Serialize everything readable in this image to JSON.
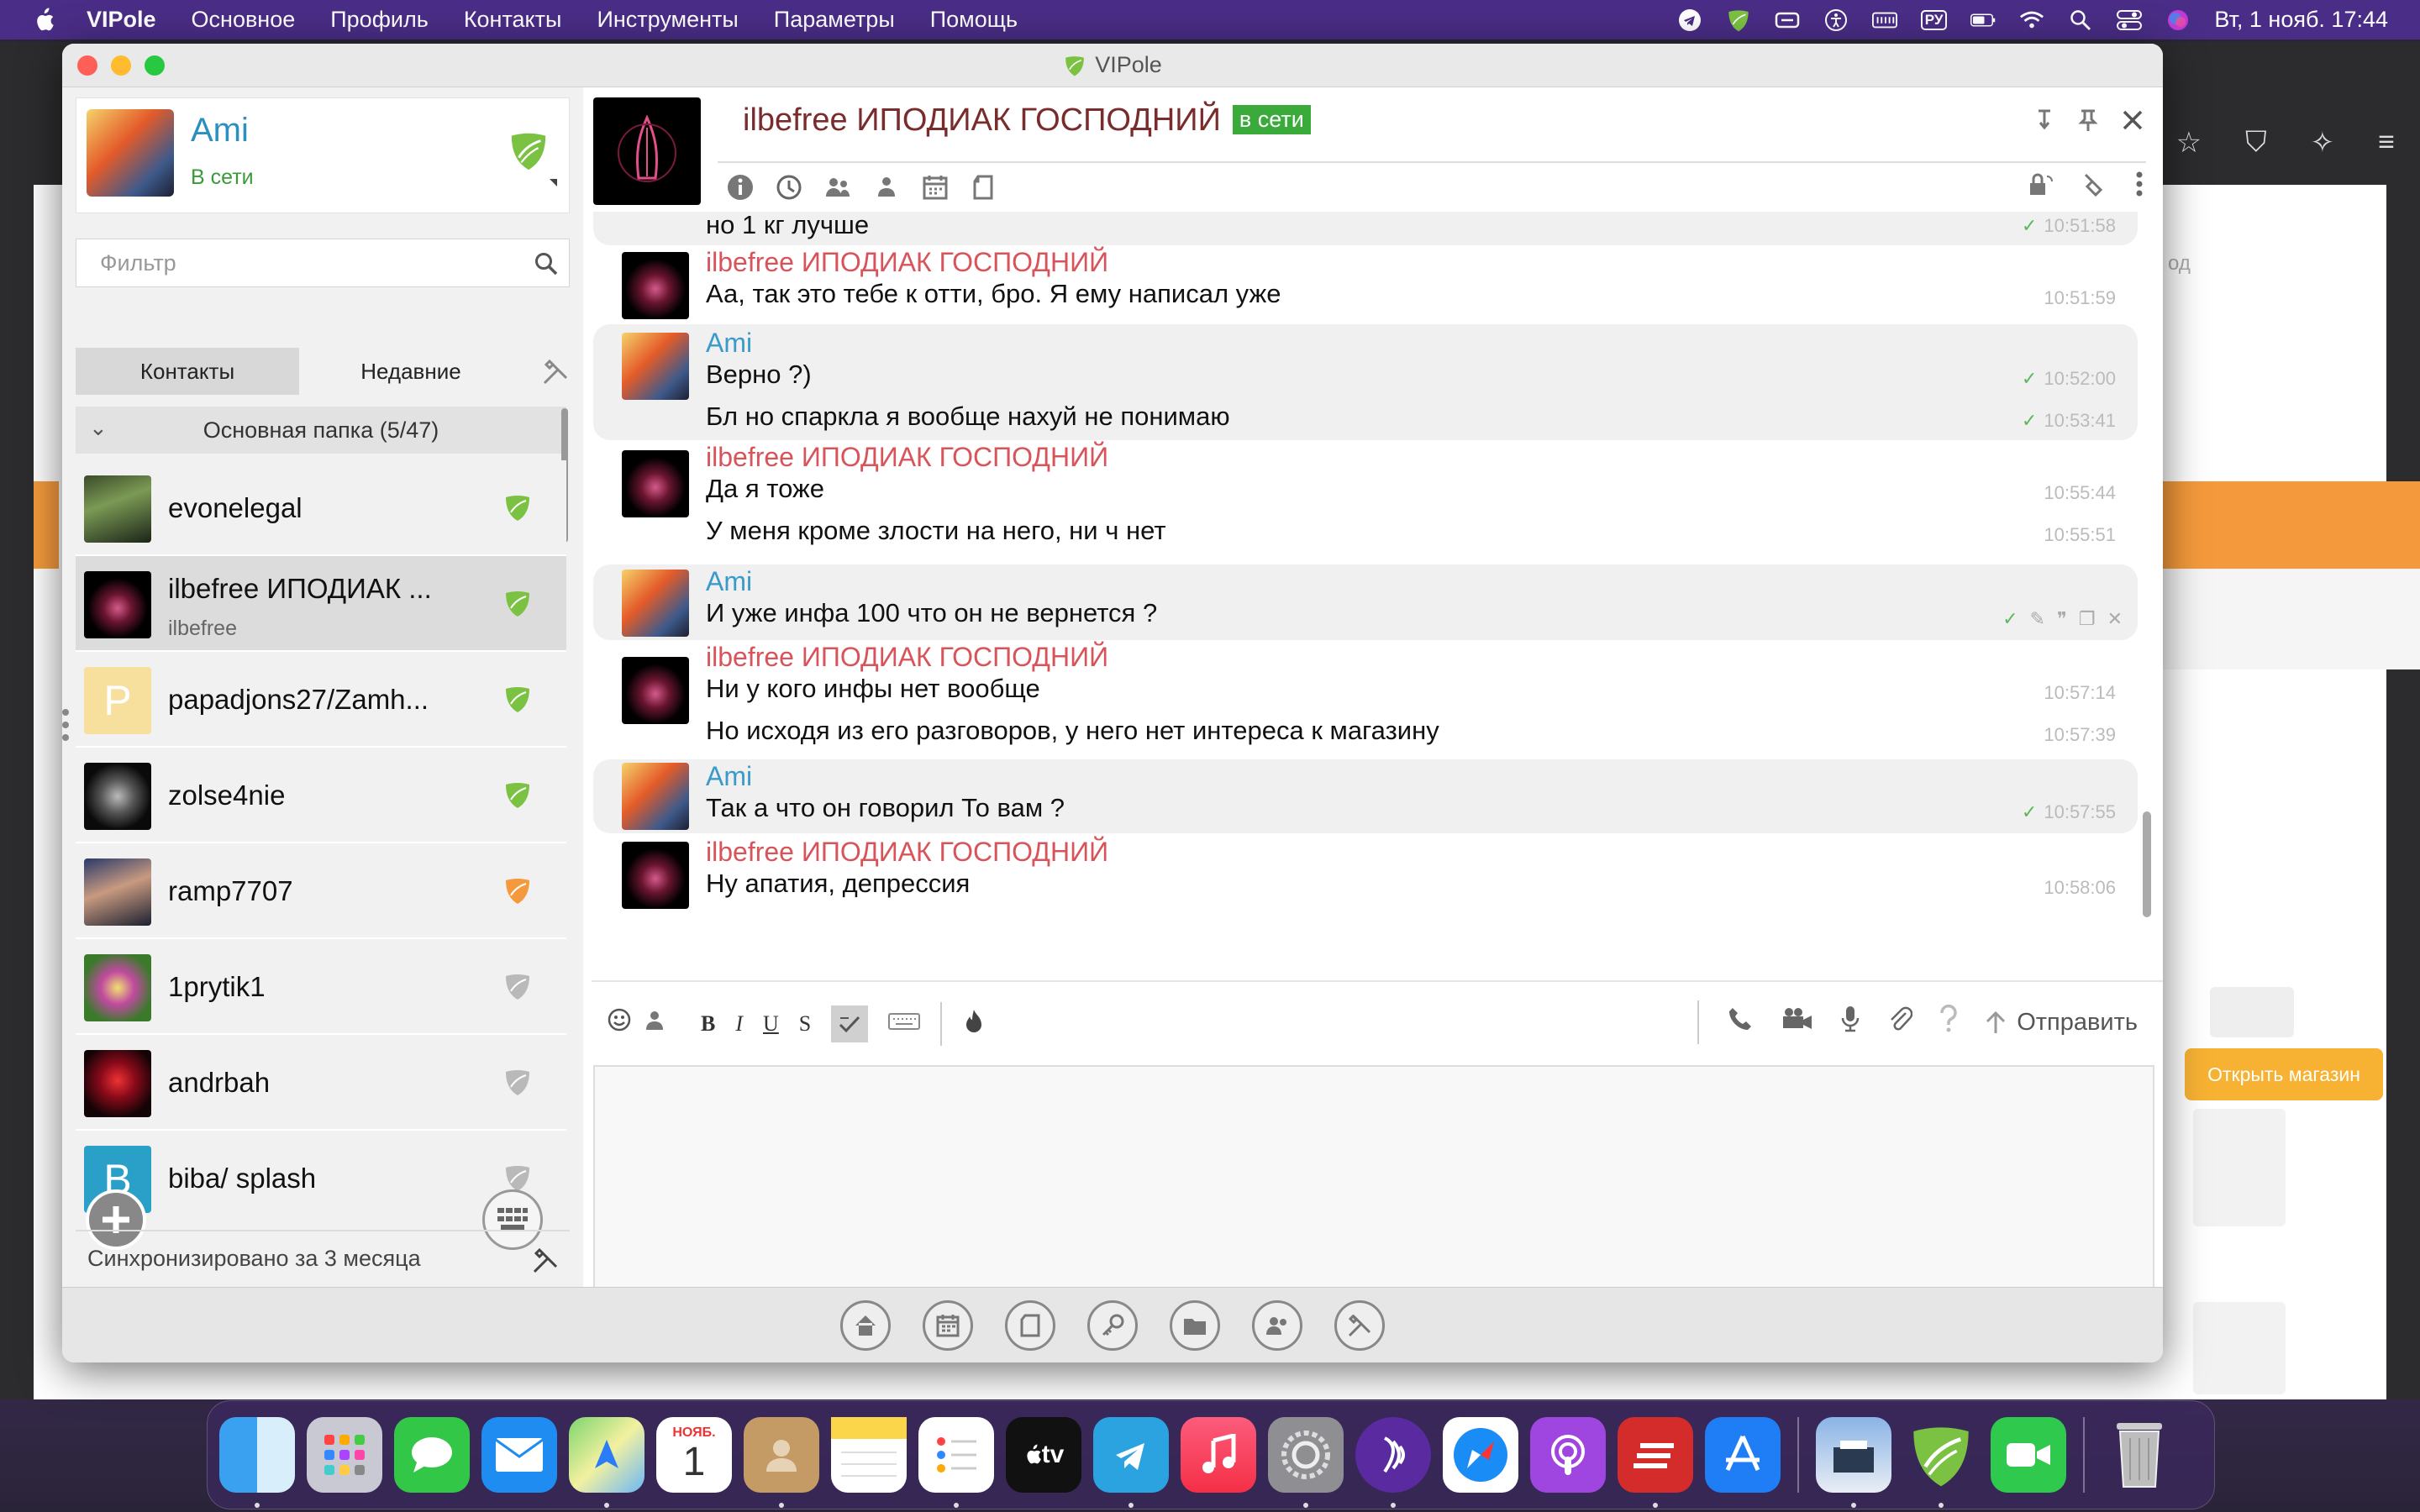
{
  "menubar": {
    "app": "VIPole",
    "items": [
      "Основное",
      "Профиль",
      "Контакты",
      "Инструменты",
      "Параметры",
      "Помощь"
    ],
    "keyboard": "РУ",
    "datetime": "Вт, 1 нояб.  17:44"
  },
  "browser": {
    "open_shop_button": "Открыть магазин",
    "fragment_label": "од"
  },
  "window": {
    "title": "VIPole"
  },
  "profile": {
    "name": "Ami",
    "status": "В сети"
  },
  "filter": {
    "placeholder": "Фильтр"
  },
  "tabs": {
    "contacts": "Контакты",
    "recent": "Недавние"
  },
  "folder": {
    "label": "Основная папка (5/47)"
  },
  "contacts": [
    {
      "name": "evonelegal",
      "sub": "",
      "shield": "green"
    },
    {
      "name": "ilbefree  ИПОДИАК ...",
      "sub": "ilbefree",
      "shield": "green"
    },
    {
      "name": "papadjons27/Zamh...",
      "sub": "",
      "shield": "green",
      "letter": "P"
    },
    {
      "name": "zolse4nie",
      "sub": "",
      "shield": "green"
    },
    {
      "name": "ramp7707",
      "sub": "",
      "shield": "orange"
    },
    {
      "name": "1prytik1",
      "sub": "",
      "shield": "gray"
    },
    {
      "name": "andrbah",
      "sub": "",
      "shield": "gray"
    },
    {
      "name": "biba/ splash",
      "sub": "",
      "shield": "gray",
      "letter": "B"
    }
  ],
  "sync": {
    "label": "Синхронизировано за 3 месяца"
  },
  "chat": {
    "title": "ilbefree  ИПОДИАК ГОСПОДНИЙ",
    "status": "в сети",
    "messages": [
      {
        "sender": "",
        "text": "но 1 кг лучше",
        "time": "10:51:58",
        "check": true
      },
      {
        "sender": "ilbefree  ИПОДИАК ГОСПОДНИЙ",
        "text": "Аа, так это тебе к отти, бро. Я ему написал уже",
        "time": "10:51:59",
        "check": false
      },
      {
        "sender": "Ami",
        "text": "Верно ?)",
        "time": "10:52:00",
        "check": true
      },
      {
        "sender": "",
        "text": "Бл но спаркла я вообще нахуй не понимаю",
        "time": "10:53:41",
        "check": true
      },
      {
        "sender": "ilbefree  ИПОДИАК ГОСПОДНИЙ",
        "text": "Да я тоже",
        "time": "10:55:44",
        "check": false
      },
      {
        "sender": "",
        "text": "У меня кроме злости на него, ни ч нет",
        "time": "10:55:51",
        "check": false
      },
      {
        "sender": "Ami",
        "text": "И уже инфа 100 что он не вернется ?",
        "time": "",
        "check": true
      },
      {
        "sender": "ilbefree  ИПОДИАК ГОСПОДНИЙ",
        "text": "Ни у кого инфы нет вообще",
        "time": "10:57:14",
        "check": false
      },
      {
        "sender": "",
        "text": "Но исходя из его разговоров, у него нет интереса к магазину",
        "time": "10:57:39",
        "check": false
      },
      {
        "sender": "Ami",
        "text": "Так а что он говорил То вам ?",
        "time": "10:57:55",
        "check": true
      },
      {
        "sender": "ilbefree  ИПОДИАК ГОСПОДНИЙ",
        "text": "Ну апатия, депрессия",
        "time": "10:58:06",
        "check": false
      }
    ]
  },
  "format": {
    "bold": "B",
    "italic": "I",
    "underline": "U",
    "strike": "S",
    "send": "Отправить"
  },
  "dock": {
    "calendar_month": "НОЯБ.",
    "calendar_day": "1",
    "tv": "tv"
  },
  "colors": {
    "menubar": "#4a2d86",
    "accent_blue": "#2b8fbf",
    "sender_red": "#d8545a",
    "online_green": "#3aaa3a",
    "orange": "#f59a3c"
  }
}
